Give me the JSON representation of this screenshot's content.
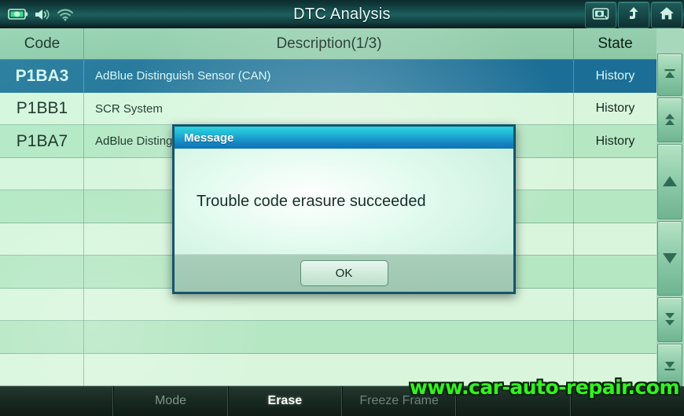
{
  "window": {
    "title": "DTC Analysis"
  },
  "status_icons": [
    {
      "name": "battery-icon"
    },
    {
      "name": "volume-icon"
    },
    {
      "name": "wifi-icon"
    }
  ],
  "top_buttons": [
    {
      "name": "screenshot-button",
      "icon": "camera-icon"
    },
    {
      "name": "back-button",
      "icon": "arrow-up-icon"
    },
    {
      "name": "home-button",
      "icon": "home-icon"
    }
  ],
  "table": {
    "columns": [
      "Code",
      "Description(1/3)",
      "State"
    ],
    "rows": [
      {
        "code": "P1BA3",
        "description": "AdBlue Distinguish Sensor (CAN)",
        "state": "History",
        "selected": true
      },
      {
        "code": "P1BB1",
        "description": "SCR System",
        "state": "History",
        "selected": false
      },
      {
        "code": "P1BA7",
        "description": "AdBlue Disting",
        "state": "History",
        "selected": false
      },
      {
        "code": "",
        "description": "",
        "state": "",
        "selected": false
      },
      {
        "code": "",
        "description": "",
        "state": "",
        "selected": false
      },
      {
        "code": "",
        "description": "",
        "state": "",
        "selected": false
      },
      {
        "code": "",
        "description": "",
        "state": "",
        "selected": false
      },
      {
        "code": "",
        "description": "",
        "state": "",
        "selected": false
      },
      {
        "code": "",
        "description": "",
        "state": "",
        "selected": false
      },
      {
        "code": "",
        "description": "",
        "state": "",
        "selected": false
      },
      {
        "code": "",
        "description": "",
        "state": "",
        "selected": false
      }
    ]
  },
  "nav_buttons": [
    {
      "name": "scroll-top-button",
      "icon": "bar-up-icon"
    },
    {
      "name": "page-up-button",
      "icon": "double-arrow-up-icon"
    },
    {
      "name": "scroll-up-button",
      "icon": "arrow-up-icon"
    },
    {
      "name": "scroll-down-button",
      "icon": "arrow-down-icon"
    },
    {
      "name": "page-down-button",
      "icon": "double-arrow-down-icon"
    },
    {
      "name": "scroll-bottom-button",
      "icon": "bar-down-icon"
    }
  ],
  "dialog": {
    "title": "Message",
    "message": "Trouble code erasure succeeded",
    "ok_label": "OK"
  },
  "toolbar": {
    "buttons": [
      {
        "label": "",
        "state": "empty"
      },
      {
        "label": "Mode",
        "state": "normal"
      },
      {
        "label": "Erase",
        "state": "active"
      },
      {
        "label": "Freeze Frame",
        "state": "dim"
      },
      {
        "label": "",
        "state": "empty"
      },
      {
        "label": "",
        "state": "empty"
      }
    ]
  },
  "watermark": {
    "text": "www.car-auto-repair.com"
  },
  "colors": {
    "titlebar": "#123f40",
    "selected_row": "#1b6e95",
    "row_odd": "#b6e7c3",
    "row_even": "#d9f6dc",
    "header_row": "#8dc8a6",
    "dialog_title": "#1484c2",
    "watermark": "#36f024",
    "toolbar_active": "#ffffff"
  }
}
